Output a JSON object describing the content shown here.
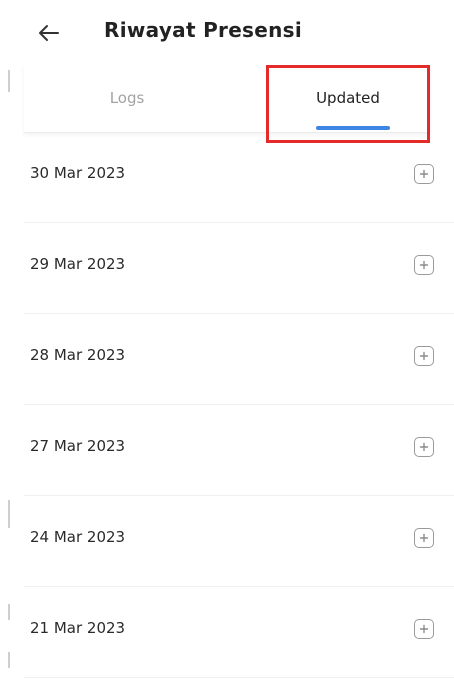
{
  "header": {
    "back_icon": "arrow-left-icon",
    "title": "Riwayat Presensi"
  },
  "tabs": [
    {
      "label": "Logs",
      "active": false
    },
    {
      "label": "Updated",
      "active": true
    }
  ],
  "colors": {
    "active_tab_indicator": "#3d86e4",
    "highlight_box": "#e52a2a",
    "inactive_tab_text": "#a3a3a3"
  },
  "list": {
    "expand_icon": "plus-square-icon",
    "items": [
      {
        "date": "30 Mar 2023"
      },
      {
        "date": "29 Mar 2023"
      },
      {
        "date": "28 Mar 2023"
      },
      {
        "date": "27 Mar 2023"
      },
      {
        "date": "24 Mar 2023"
      },
      {
        "date": "21 Mar 2023"
      }
    ]
  }
}
